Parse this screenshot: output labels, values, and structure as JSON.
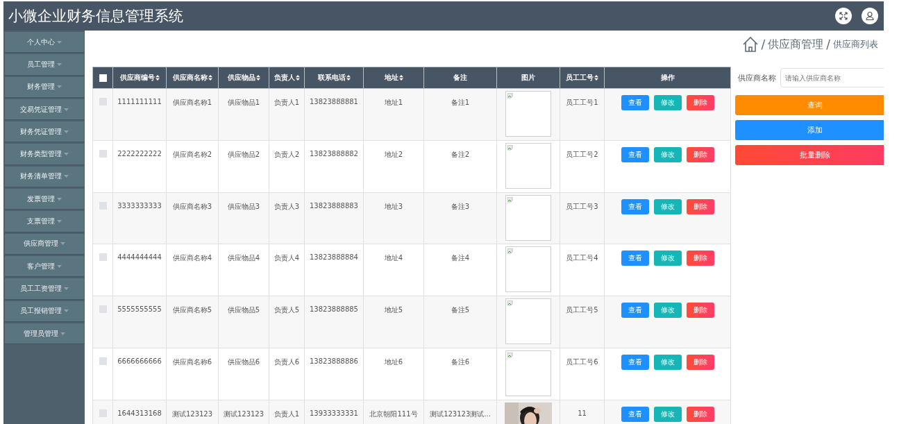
{
  "header": {
    "title": "小微企业财务信息管理系统"
  },
  "sidebar": {
    "items": [
      {
        "label": "个人中心",
        "selected": false
      },
      {
        "label": "员工管理",
        "selected": false
      },
      {
        "label": "财务管理",
        "selected": false
      },
      {
        "label": "交易凭证管理",
        "selected": false
      },
      {
        "label": "财务凭证管理",
        "selected": false
      },
      {
        "label": "财务类型管理",
        "selected": false
      },
      {
        "label": "财务清单管理",
        "selected": false
      },
      {
        "label": "发票管理",
        "selected": false
      },
      {
        "label": "支票管理",
        "selected": false
      },
      {
        "label": "供应商管理",
        "selected": false
      },
      {
        "label": "客户管理",
        "selected": false
      },
      {
        "label": "员工工资管理",
        "selected": false
      },
      {
        "label": "员工报销管理",
        "selected": false
      },
      {
        "label": "管理员管理",
        "selected": false
      }
    ]
  },
  "breadcrumb": [
    {
      "separator": "/",
      "label": "供应商管理"
    },
    {
      "separator": "/",
      "label": "供应商列表"
    }
  ],
  "search": {
    "label": "供应商名称",
    "placeholder": "请输入供应商名称"
  },
  "buttons": [
    {
      "label": "查询",
      "kind": "query"
    },
    {
      "label": "添加",
      "kind": "add"
    },
    {
      "label": "批量删除",
      "kind": "delete"
    }
  ],
  "table": {
    "select_all": {
      "checked": false
    },
    "columns": [
      {
        "label": "供应商编号",
        "sortable": true
      },
      {
        "label": "供应商名称",
        "sortable": true
      },
      {
        "label": "供应物品",
        "sortable": true
      },
      {
        "label": "负责人",
        "sortable": true
      },
      {
        "label": "联系电话",
        "sortable": true
      },
      {
        "label": "地址",
        "sortable": true
      },
      {
        "label": "备注",
        "sortable": false
      },
      {
        "label": "图片",
        "sortable": false
      },
      {
        "label": "员工工号",
        "sortable": true
      },
      {
        "label": "操作",
        "sortable": false
      }
    ],
    "rows": [
      {
        "checked": false,
        "cells": [
          "1111111111",
          "供应商名称1",
          "供应物品1",
          "负责人1",
          "13823888881",
          "地址1",
          "备注1"
        ],
        "image": {
          "kind": "broken"
        },
        "staff_no": "员工工号1",
        "actions": [
          "查看",
          "修改",
          "删除"
        ]
      },
      {
        "checked": false,
        "cells": [
          "2222222222",
          "供应商名称2",
          "供应物品2",
          "负责人2",
          "13823888882",
          "地址2",
          "备注2"
        ],
        "image": {
          "kind": "broken"
        },
        "staff_no": "员工工号2",
        "actions": [
          "查看",
          "修改",
          "删除"
        ]
      },
      {
        "checked": false,
        "cells": [
          "3333333333",
          "供应商名称3",
          "供应物品3",
          "负责人3",
          "13823888883",
          "地址3",
          "备注3"
        ],
        "image": {
          "kind": "broken"
        },
        "staff_no": "员工工号3",
        "actions": [
          "查看",
          "修改",
          "删除"
        ]
      },
      {
        "checked": false,
        "cells": [
          "4444444444",
          "供应商名称4",
          "供应物品4",
          "负责人4",
          "13823888884",
          "地址4",
          "备注4"
        ],
        "image": {
          "kind": "broken"
        },
        "staff_no": "员工工号4",
        "actions": [
          "查看",
          "修改",
          "删除"
        ]
      },
      {
        "checked": false,
        "cells": [
          "5555555555",
          "供应商名称5",
          "供应物品5",
          "负责人5",
          "13823888885",
          "地址5",
          "备注5"
        ],
        "image": {
          "kind": "broken"
        },
        "staff_no": "员工工号5",
        "actions": [
          "查看",
          "修改",
          "删除"
        ]
      },
      {
        "checked": false,
        "cells": [
          "6666666666",
          "供应商名称6",
          "供应物品6",
          "负责人6",
          "13823888886",
          "地址6",
          "备注6"
        ],
        "image": {
          "kind": "broken"
        },
        "staff_no": "员工工号6",
        "actions": [
          "查看",
          "修改",
          "删除"
        ]
      },
      {
        "checked": false,
        "cells": [
          "1644313168",
          "测试123123",
          "测试123123",
          "负责人1",
          "13933333331",
          "北京朝阳111号",
          "测试123123测试..."
        ],
        "staff_no": "11",
        "actions": [
          "查看",
          "修改",
          "删除"
        ]
      }
    ]
  }
}
